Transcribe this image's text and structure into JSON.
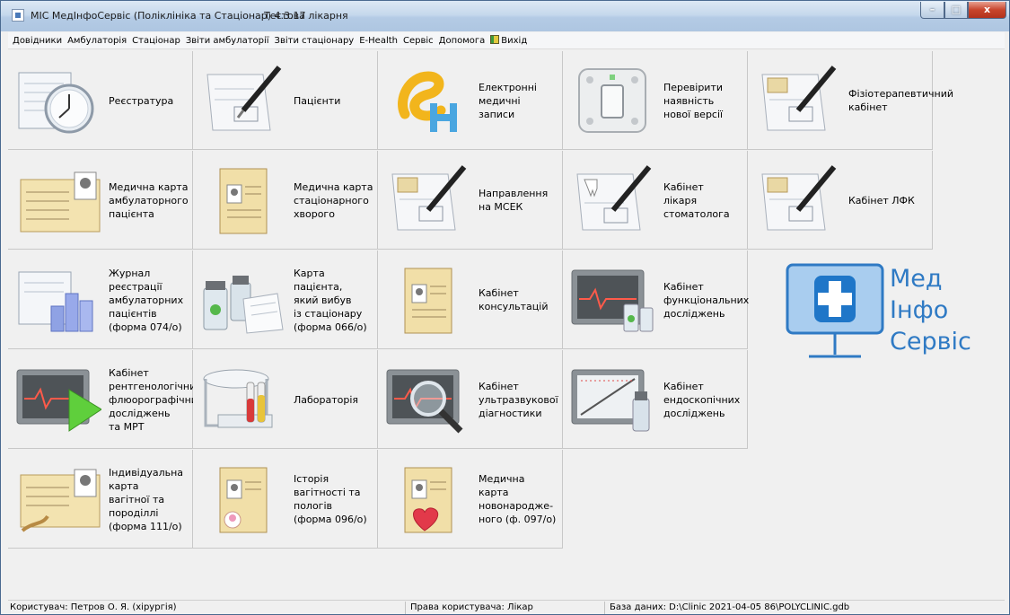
{
  "window": {
    "title": "МІС МедІнфоСервіс (Поліклініка та Стаціонар) 4.3.17",
    "subtitle": "Тестова лікарня",
    "minimize": "–",
    "maximize": "□",
    "close": "x"
  },
  "menu": [
    "Довідники",
    "Амбулаторія",
    "Стаціонар",
    "Звіти амбулаторії",
    "Звіти стаціонару",
    "E-Health",
    "Сервіс",
    "Допомога",
    "Вихід"
  ],
  "tiles": {
    "registry": "Реєстратура",
    "patients": "Пацієнти",
    "emr": "Електронні\nмедичні\nзаписи",
    "update": "Перевірити\nнаявність\nнової версії",
    "physio": "Фізіотерапевтичний\nкабінет",
    "outpatient_card": "Медична карта\nамбулаторного\nпацієнта",
    "inpatient_card": "Медична карта\nстаціонарного\nхворого",
    "msek": "Направлення\nна МСЕК",
    "dentist": "Кабінет\nлікаря\nстоматолога",
    "lfk": "Кабінет ЛФК",
    "journal": "Журнал\nреєстрації\nамбулаторних\nпацієнтів\n(форма 074/о)",
    "discharge_card": "Карта пацієнта,\nякий вибув\nіз стаціонару\n(форма 066/о)",
    "consult": "Кабінет\nконсультацій",
    "functional": "Кабінет\nфункціональних\nдосліджень",
    "xray": "Кабінет\nрентгенологічних,\nфлюорографічних\nдосліджень\nта МРТ",
    "lab": "Лабораторія",
    "ultrasound": "Кабінет\nультразвукової\nдіагностики",
    "endoscopy": "Кабінет\nендоскопічних\nдосліджень",
    "pregnancy_card": "Індивідуальна\nкарта\nвагітної та\nпороділлі\n(форма 111/о)",
    "birth_history": "Історія\nвагітності та\nпологів\n(форма 096/о)",
    "newborn_card": "Медична\nкарта\nновонародже-\nного (ф. 097/о)"
  },
  "logo": {
    "text": "Мед\nІнфо\nСервіс",
    "color": "#2f7ac4"
  },
  "status": {
    "user": "Користувач: Петров О. Я. (хірургія)",
    "rights": "Права користувача: Лікар",
    "db": "База даних: D:\\Clinic 2021-04-05 86\\POLYCLINIC.gdb"
  }
}
